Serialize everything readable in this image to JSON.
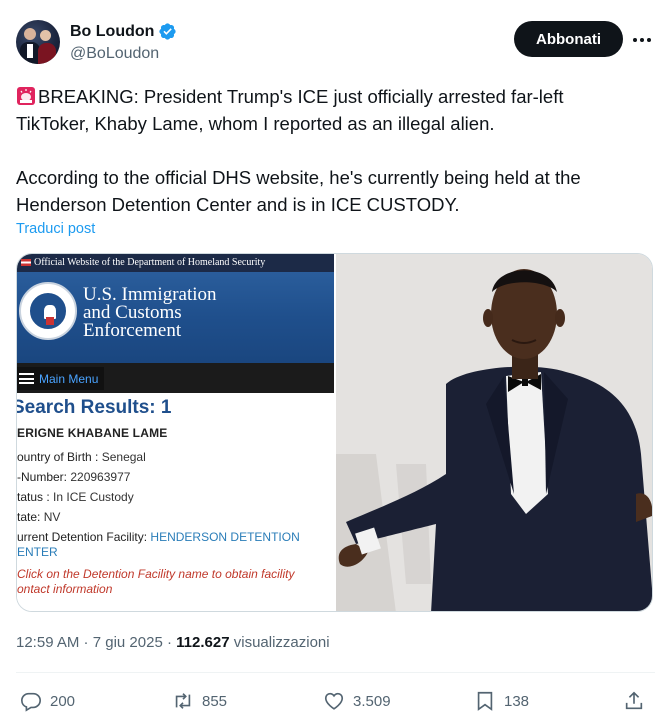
{
  "author": {
    "display_name": "Bo Loudon",
    "handle": "@BoLoudon",
    "verified": true
  },
  "header": {
    "follow_label": "Abbonati",
    "more_icon": "more-horizontal-icon"
  },
  "tweet": {
    "line1": "BREAKING: President Trump's ICE just officially arrested far-left",
    "line2": "TikToker, Khaby Lame, whom I reported as an illegal alien.",
    "line3": "According to the official DHS website, he's currently being held at the",
    "line4": "Henderson Detention Center and is in ICE CUSTODY.",
    "emoji_icon": "police-siren-icon",
    "translate_label": "Traduci post"
  },
  "media": {
    "left": {
      "banner": "Official Website of the Department of Homeland Security",
      "agency_line1": "U.S. Immigration",
      "agency_line2": "and Customs",
      "agency_line3": "Enforcement",
      "menu_label": "Main Menu",
      "results_title": "Search Results: 1",
      "person_name": "ERIGNE KHABANE LAME",
      "country_label": "ountry of Birth :",
      "country_value": "Senegal",
      "anumber_label": "-Number:",
      "anumber_value": "220963977",
      "status_label": "tatus :",
      "status_value": "In ICE Custody",
      "state_label": "tate:",
      "state_value": "NV",
      "facility_label": "urrent Detention Facility:",
      "facility_value_1": "HENDERSON DETENTION",
      "facility_value_2": "ENTER",
      "note_1": "Click on the Detention Facility name to obtain facility",
      "note_2": "ontact information"
    },
    "right": {
      "alt_description": "photo"
    }
  },
  "meta": {
    "time": "12:59 AM",
    "sep1": " · ",
    "date": "7 giu 2025",
    "sep2": " · ",
    "views_count": "112.627",
    "views_label": " visualizzazioni"
  },
  "actions": {
    "replies": "200",
    "reposts": "855",
    "likes": "3.509",
    "bookmarks": "138"
  },
  "colors": {
    "accent": "#1d9bf0",
    "text": "#0f1419",
    "muted": "#536471",
    "ice_blue": "#1f4f8c"
  }
}
